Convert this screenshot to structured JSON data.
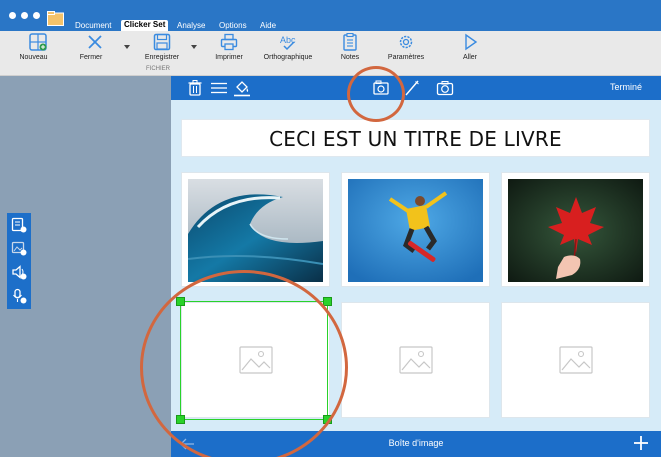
{
  "menu": {
    "tabs": [
      {
        "label": "Document"
      },
      {
        "label": "Clicker Set"
      },
      {
        "label": "Analyse"
      },
      {
        "label": "Options"
      },
      {
        "label": "Aide"
      }
    ],
    "active_tab": "Clicker Set"
  },
  "ribbon": {
    "buttons": [
      {
        "label": "Nouveau",
        "icon": "new-grid-icon"
      },
      {
        "label": "Fermer",
        "icon": "close-x-icon"
      },
      {
        "label": "Enregistrer",
        "icon": "save-icon"
      },
      {
        "label": "Imprimer",
        "icon": "print-icon"
      },
      {
        "label": "Orthographique",
        "icon": "spellcheck-icon"
      },
      {
        "label": "Notes",
        "icon": "notes-icon"
      },
      {
        "label": "Paramètres",
        "icon": "gear-icon"
      },
      {
        "label": "Aller",
        "icon": "play-icon"
      }
    ],
    "group_label": "FICHIER"
  },
  "left_toolbar": {
    "icons": [
      "add-picture-set-icon",
      "add-image-icon",
      "add-sound-icon",
      "add-recording-icon"
    ]
  },
  "editor": {
    "topbar_icons": [
      "trash-icon",
      "menu-icon",
      "paint-bucket-icon",
      "image-browse-icon",
      "pencil-icon",
      "camera-icon"
    ],
    "done_label": "Terminé",
    "title_text": "CECI EST UN TITRE DE LIVRE",
    "bottom_label": "Boîte d'image",
    "cards": [
      {
        "kind": "photo",
        "subject": "ocean-wave"
      },
      {
        "kind": "photo",
        "subject": "skateboarder-jump"
      },
      {
        "kind": "photo",
        "subject": "red-maple-leaf"
      },
      {
        "kind": "placeholder",
        "selected": true
      },
      {
        "kind": "placeholder",
        "selected": false
      },
      {
        "kind": "placeholder",
        "selected": false
      }
    ]
  },
  "colors": {
    "accent_blue": "#1c6ec9",
    "editor_bg": "#d6ebf8",
    "side_panel": "#8ba0b5",
    "selection_green": "#2ad22a",
    "annotation_ring": "#d2673f"
  }
}
